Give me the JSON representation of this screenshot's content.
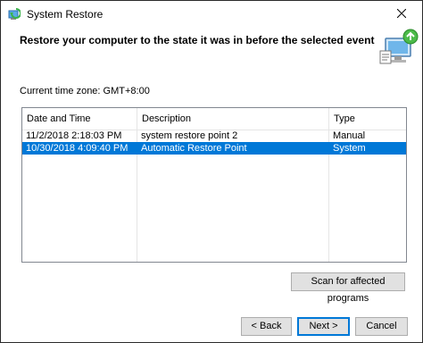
{
  "window": {
    "title": "System Restore"
  },
  "header": {
    "heading": "Restore your computer to the state it was in before the selected event"
  },
  "timezone": "Current time zone: GMT+8:00",
  "table": {
    "columns": [
      "Date and Time",
      "Description",
      "Type"
    ],
    "rows": [
      {
        "date": "11/2/2018 2:18:03 PM",
        "description": "system restore point 2",
        "type": "Manual",
        "selected": false
      },
      {
        "date": "10/30/2018 4:09:40 PM",
        "description": "Automatic Restore Point",
        "type": "System",
        "selected": true
      }
    ]
  },
  "buttons": {
    "scan": "Scan for affected programs",
    "back": "< Back",
    "next": "Next >",
    "cancel": "Cancel"
  },
  "colors": {
    "selection": "#0078d7",
    "button_face": "#e1e1e1",
    "border": "#828790"
  },
  "icons": {
    "app": "system-restore-icon",
    "close": "close-icon",
    "header": "restore-graphic-icon"
  }
}
